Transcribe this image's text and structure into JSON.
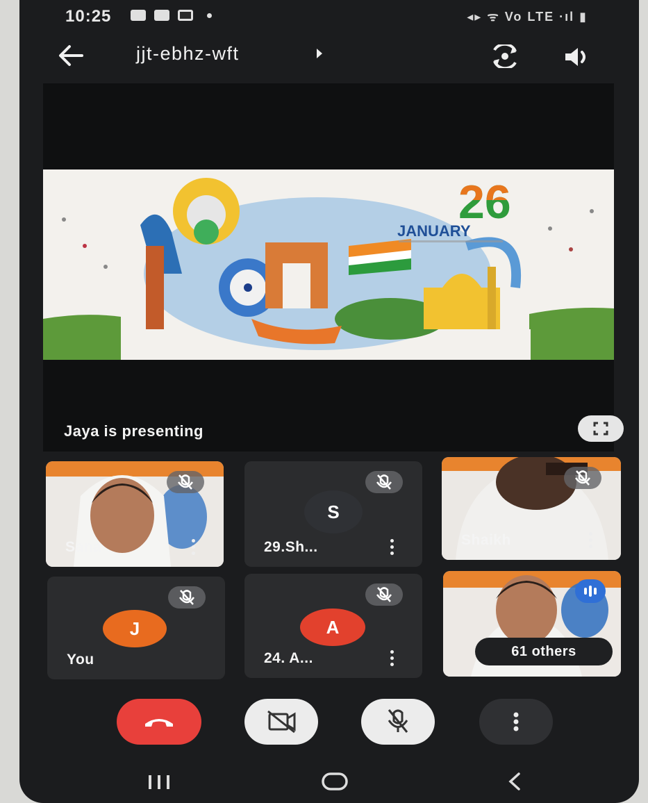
{
  "status_bar": {
    "time": "10:25",
    "right_indicators": "◂▸ ᯤ Vo LTE ·ıl ▮"
  },
  "app_bar": {
    "meeting_code": "jjt-ebhz-wft"
  },
  "stage": {
    "presenting_label": "Jaya is presenting",
    "slide": {
      "big_number": "26",
      "month": "JANUARY"
    }
  },
  "participants": [
    {
      "name": "Sana",
      "type": "video",
      "muted": true
    },
    {
      "name": "29.Sh...",
      "type": "avatar",
      "initial": "S",
      "avatar_color": "#2f3135",
      "muted": true
    },
    {
      "name": "Shaikh",
      "type": "video",
      "muted": true
    },
    {
      "name": "You",
      "type": "avatar",
      "initial": "J",
      "avatar_color": "#e86b1f",
      "muted": true
    },
    {
      "name": "24. A...",
      "type": "avatar",
      "initial": "A",
      "avatar_color": "#e2412d",
      "muted": true
    },
    {
      "name": "61 others",
      "type": "video-group"
    }
  ],
  "colors": {
    "end_call": "#e8403b",
    "background": "#1b1c1e",
    "tile": "#2b2c2e"
  },
  "controls": [
    "end-call",
    "camera-off",
    "mic-off",
    "more-options"
  ],
  "nav_bar": [
    "recents",
    "home",
    "back"
  ]
}
